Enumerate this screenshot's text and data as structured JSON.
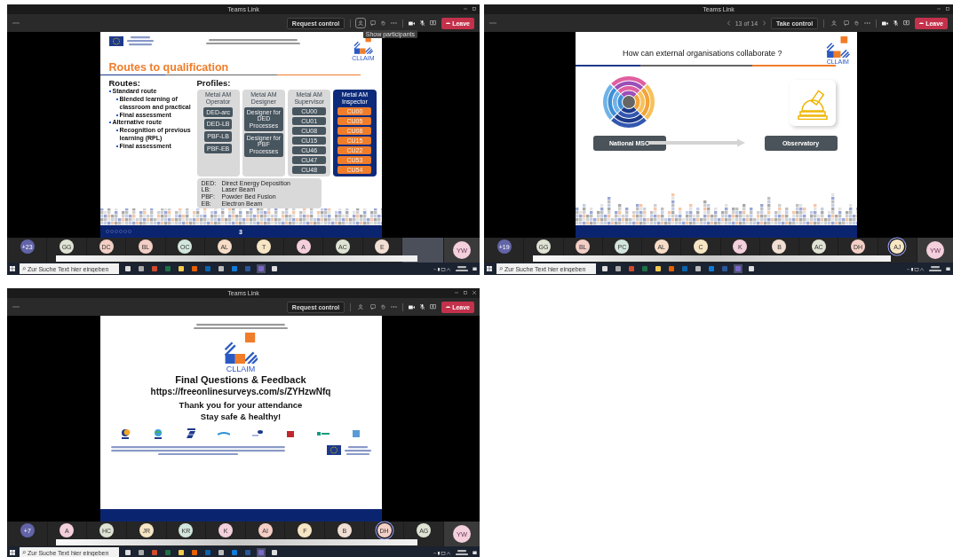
{
  "screens": [
    {
      "window_title": "Teams Link",
      "toolbar": {
        "control_button": "Request control",
        "tooltip": "Show participants",
        "leave_button": "Leave"
      },
      "slide": {
        "kind": "routes",
        "logo_text": "CLLAIM",
        "title": "Routes to qualification",
        "routes_heading": "Routes:",
        "routes": [
          {
            "text": "Standard route",
            "children": [
              {
                "text": "Blended learning of classroom and practical"
              },
              {
                "text": "Final assessment"
              }
            ]
          },
          {
            "text": "Alternative route",
            "children": [
              {
                "text": "Recognition of previous learning (RPL)"
              },
              {
                "text": "Final assessment"
              }
            ]
          }
        ],
        "profiles_heading": "Profiles:",
        "profiles": [
          {
            "title": "Metal AM Operator",
            "highlighted": false,
            "kind": "large",
            "items": [
              "DED-arc",
              "DED-LB",
              "PBF-LB",
              "PBF-EB"
            ]
          },
          {
            "title": "Metal AM Designer",
            "highlighted": false,
            "kind": "large",
            "items": [
              "Designer for DED Processes",
              "Designer for PBF Processes"
            ]
          },
          {
            "title": "Metal AM Supervisor",
            "highlighted": false,
            "kind": "small",
            "items": [
              "CU00",
              "CU01",
              "CU08",
              "CU15",
              "CU46",
              "CU47",
              "CU48"
            ]
          },
          {
            "title": "Metal AM Inspector",
            "highlighted": true,
            "kind": "small",
            "items": [
              "CU00",
              "CU05",
              "CU08",
              "CU15",
              "CU22",
              "CU53",
              "CU54"
            ]
          }
        ],
        "legend": [
          {
            "abbr": "DED:",
            "text": "Direct Energy Deposition"
          },
          {
            "abbr": "LB:",
            "text": "Laser Beam"
          },
          {
            "abbr": "PBF:",
            "text": "Powder Bed Fusion"
          },
          {
            "abbr": "EB:",
            "text": "Electron Beam"
          }
        ],
        "page_number": "3"
      },
      "video_tile": true,
      "participants": [
        {
          "initials": "+23",
          "color": "#6264a7",
          "speaking": false
        },
        {
          "initials": "GG",
          "color": "#dfe3d3",
          "speaking": false
        },
        {
          "initials": "DC",
          "color": "#f4cfc6",
          "speaking": false
        },
        {
          "initials": "BL",
          "color": "#f4cfc6",
          "speaking": false
        },
        {
          "initials": "OC",
          "color": "#d3e6de",
          "speaking": false
        },
        {
          "initials": "AL",
          "color": "#f7dcc8",
          "speaking": false
        },
        {
          "initials": "T",
          "color": "#f7e6c4",
          "speaking": false
        },
        {
          "initials": "A",
          "color": "#f4cfdc",
          "speaking": false
        },
        {
          "initials": "AC",
          "color": "#dfe3d3",
          "speaking": false
        },
        {
          "initials": "E",
          "color": "#f2dfd3",
          "speaking": false
        }
      ],
      "self_avatar": "YW",
      "taskbar": {
        "search_placeholder": "Zur Suche Text hier eingeben"
      }
    },
    {
      "window_title": "Teams Link",
      "toolbar": {
        "pager": "13 of 14",
        "control_button": "Take control",
        "leave_button": "Leave"
      },
      "slide": {
        "kind": "collaboration",
        "title": "How can external organisations collaborate ?",
        "logo_text": "CLLAIM",
        "from_box": "National MSC",
        "to_box": "Observatory"
      },
      "video_tile": false,
      "participants": [
        {
          "initials": "+19",
          "color": "#6264a7",
          "speaking": false
        },
        {
          "initials": "GG",
          "color": "#dfe3d3",
          "speaking": false
        },
        {
          "initials": "BL",
          "color": "#f4cfc6",
          "speaking": false
        },
        {
          "initials": "PC",
          "color": "#d3e6de",
          "speaking": false
        },
        {
          "initials": "AL",
          "color": "#f7dcc8",
          "speaking": false
        },
        {
          "initials": "C",
          "color": "#f7e6c4",
          "speaking": false
        },
        {
          "initials": "K",
          "color": "#f4cfdc",
          "speaking": false
        },
        {
          "initials": "B",
          "color": "#f2dfd3",
          "speaking": false
        },
        {
          "initials": "AC",
          "color": "#dfe3d3",
          "speaking": false
        },
        {
          "initials": "DH",
          "color": "#f4cfc6",
          "speaking": false
        },
        {
          "initials": "AJ",
          "color": "#f7e6c4",
          "speaking": true
        }
      ],
      "self_avatar": "YW",
      "taskbar": {
        "search_placeholder": "Zur Suche Text hier eingeben"
      }
    },
    {
      "window_title": "Teams Link",
      "toolbar": {
        "control_button": "Request control",
        "leave_button": "Leave"
      },
      "slide": {
        "kind": "closing",
        "logo_text": "CLLAIM",
        "heading": "Final Questions & Feedback",
        "link": "https://freeonlinesurveys.com/s/ZYHzwNfq",
        "thanks": "Thank you for your attendance",
        "farewell": "Stay safe & healthy!",
        "partners": [
          {
            "kind": "crescent"
          },
          {
            "kind": "globe"
          },
          {
            "kind": "stripes"
          },
          {
            "kind": "wave"
          },
          {
            "kind": "oval"
          },
          {
            "kind": "block"
          },
          {
            "kind": "square"
          },
          {
            "kind": "badge"
          }
        ]
      },
      "video_tile": false,
      "participants": [
        {
          "initials": "+7",
          "color": "#6264a7",
          "speaking": false
        },
        {
          "initials": "A",
          "color": "#f4cfdc",
          "speaking": false
        },
        {
          "initials": "HC",
          "color": "#dfe3d3",
          "speaking": false
        },
        {
          "initials": "JR",
          "color": "#f7e6c4",
          "speaking": false
        },
        {
          "initials": "KR",
          "color": "#d3e6de",
          "speaking": false
        },
        {
          "initials": "K",
          "color": "#f4cfdc",
          "speaking": false
        },
        {
          "initials": "AI",
          "color": "#f4cfc6",
          "speaking": false
        },
        {
          "initials": "F",
          "color": "#f7e6c4",
          "speaking": false
        },
        {
          "initials": "B",
          "color": "#f2dfd3",
          "speaking": false
        },
        {
          "initials": "DH",
          "color": "#f4cfc6",
          "speaking": true
        },
        {
          "initials": "AG",
          "color": "#dfe3d3",
          "speaking": false
        }
      ],
      "self_avatar": "YW",
      "taskbar": {
        "search_placeholder": "Zur Suche Text hier eingeben"
      }
    }
  ]
}
